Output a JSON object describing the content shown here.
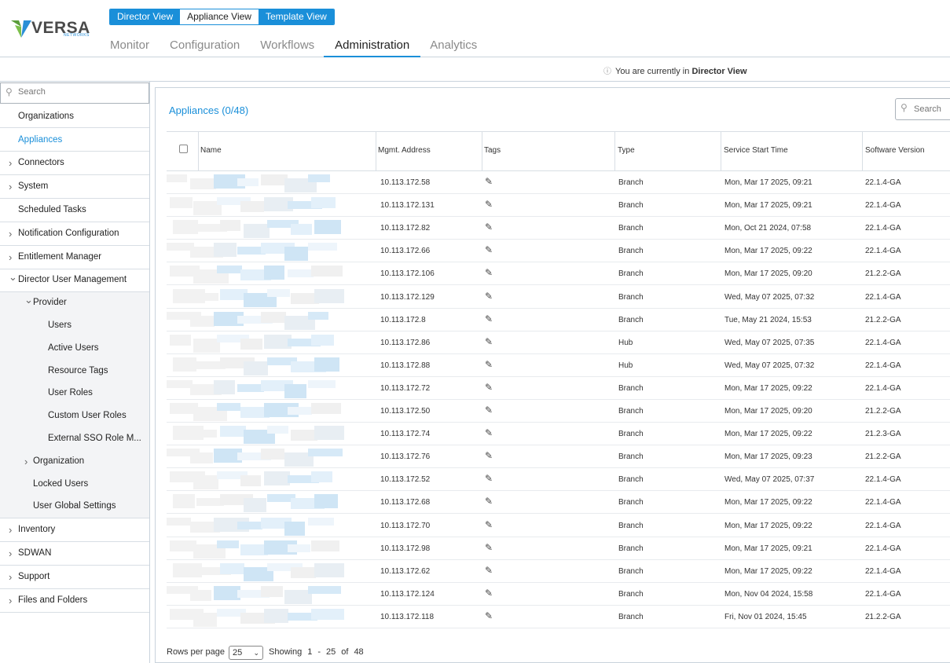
{
  "logo": {
    "text": "VERSA",
    "sub": "NETWORKS"
  },
  "views": [
    {
      "label": "Director View",
      "active": true
    },
    {
      "label": "Appliance View",
      "active": false
    },
    {
      "label": "Template View",
      "active": true
    }
  ],
  "main_tabs": [
    {
      "label": "Monitor",
      "active": false
    },
    {
      "label": "Configuration",
      "active": false
    },
    {
      "label": "Workflows",
      "active": false
    },
    {
      "label": "Administration",
      "active": true
    },
    {
      "label": "Analytics",
      "active": false
    }
  ],
  "info": {
    "prefix": "You are currently in",
    "view": "Director View"
  },
  "sidebar": {
    "search_placeholder": "Search",
    "items": [
      {
        "label": "Organizations",
        "level": 0,
        "chevron": ""
      },
      {
        "label": "Appliances",
        "level": 0,
        "chevron": "",
        "active": true
      },
      {
        "label": "Connectors",
        "level": 0,
        "chevron": "right"
      },
      {
        "label": "System",
        "level": 0,
        "chevron": "right"
      },
      {
        "label": "Scheduled Tasks",
        "level": 0,
        "chevron": ""
      },
      {
        "label": "Notification Configuration",
        "level": 0,
        "chevron": "right"
      },
      {
        "label": "Entitlement Manager",
        "level": 0,
        "chevron": "right"
      },
      {
        "label": "Director User Management",
        "level": 0,
        "chevron": "down"
      },
      {
        "label": "Provider",
        "level": 1,
        "chevron": "down"
      },
      {
        "label": "Users",
        "level": 2,
        "chevron": ""
      },
      {
        "label": "Active Users",
        "level": 2,
        "chevron": ""
      },
      {
        "label": "Resource Tags",
        "level": 2,
        "chevron": ""
      },
      {
        "label": "User Roles",
        "level": 2,
        "chevron": ""
      },
      {
        "label": "Custom User Roles",
        "level": 2,
        "chevron": ""
      },
      {
        "label": "External SSO Role M...",
        "level": 2,
        "chevron": ""
      },
      {
        "label": "Organization",
        "level": 1,
        "chevron": "right"
      },
      {
        "label": "Locked Users",
        "level": 1,
        "chevron": ""
      },
      {
        "label": "User Global Settings",
        "level": 1,
        "chevron": ""
      },
      {
        "label": "Inventory",
        "level": 0,
        "chevron": "right"
      },
      {
        "label": "SDWAN",
        "level": 0,
        "chevron": "right"
      },
      {
        "label": "Support",
        "level": 0,
        "chevron": "right"
      },
      {
        "label": "Files and Folders",
        "level": 0,
        "chevron": "right"
      }
    ]
  },
  "appliances": {
    "title": "Appliances (0/48)",
    "search_placeholder": "Search",
    "columns": [
      "Name",
      "Mgmt. Address",
      "Tags",
      "Type",
      "Service Start Time",
      "Software Version"
    ],
    "rows": [
      {
        "mgmt": "10.113.172.58",
        "type": "Branch",
        "start": "Mon, Mar 17 2025, 09:21",
        "version": "22.1.4-GA"
      },
      {
        "mgmt": "10.113.172.131",
        "type": "Branch",
        "start": "Mon, Mar 17 2025, 09:21",
        "version": "22.1.4-GA"
      },
      {
        "mgmt": "10.113.172.82",
        "type": "Branch",
        "start": "Mon, Oct 21 2024, 07:58",
        "version": "22.1.4-GA"
      },
      {
        "mgmt": "10.113.172.66",
        "type": "Branch",
        "start": "Mon, Mar 17 2025, 09:22",
        "version": "22.1.4-GA"
      },
      {
        "mgmt": "10.113.172.106",
        "type": "Branch",
        "start": "Mon, Mar 17 2025, 09:20",
        "version": "21.2.2-GA"
      },
      {
        "mgmt": "10.113.172.129",
        "type": "Branch",
        "start": "Wed, May 07 2025, 07:32",
        "version": "22.1.4-GA"
      },
      {
        "mgmt": "10.113.172.8",
        "type": "Branch",
        "start": "Tue, May 21 2024, 15:53",
        "version": "21.2.2-GA"
      },
      {
        "mgmt": "10.113.172.86",
        "type": "Hub",
        "start": "Wed, May 07 2025, 07:35",
        "version": "22.1.4-GA"
      },
      {
        "mgmt": "10.113.172.88",
        "type": "Hub",
        "start": "Wed, May 07 2025, 07:32",
        "version": "22.1.4-GA"
      },
      {
        "mgmt": "10.113.172.72",
        "type": "Branch",
        "start": "Mon, Mar 17 2025, 09:22",
        "version": "22.1.4-GA"
      },
      {
        "mgmt": "10.113.172.50",
        "type": "Branch",
        "start": "Mon, Mar 17 2025, 09:20",
        "version": "21.2.2-GA"
      },
      {
        "mgmt": "10.113.172.74",
        "type": "Branch",
        "start": "Mon, Mar 17 2025, 09:22",
        "version": "21.2.3-GA"
      },
      {
        "mgmt": "10.113.172.76",
        "type": "Branch",
        "start": "Mon, Mar 17 2025, 09:23",
        "version": "21.2.2-GA"
      },
      {
        "mgmt": "10.113.172.52",
        "type": "Branch",
        "start": "Wed, May 07 2025, 07:37",
        "version": "22.1.4-GA"
      },
      {
        "mgmt": "10.113.172.68",
        "type": "Branch",
        "start": "Mon, Mar 17 2025, 09:22",
        "version": "22.1.4-GA"
      },
      {
        "mgmt": "10.113.172.70",
        "type": "Branch",
        "start": "Mon, Mar 17 2025, 09:22",
        "version": "22.1.4-GA"
      },
      {
        "mgmt": "10.113.172.98",
        "type": "Branch",
        "start": "Mon, Mar 17 2025, 09:21",
        "version": "22.1.4-GA"
      },
      {
        "mgmt": "10.113.172.62",
        "type": "Branch",
        "start": "Mon, Mar 17 2025, 09:22",
        "version": "22.1.4-GA"
      },
      {
        "mgmt": "10.113.172.124",
        "type": "Branch",
        "start": "Mon, Nov 04 2024, 15:58",
        "version": "22.1.4-GA"
      },
      {
        "mgmt": "10.113.172.118",
        "type": "Branch",
        "start": "Fri, Nov 01 2024, 15:45",
        "version": "21.2.2-GA"
      }
    ]
  },
  "footer": {
    "rows_per_page_label": "Rows per page",
    "rows_per_page": "25",
    "showing_label": "Showing",
    "from": "1",
    "dash": "-",
    "to": "25",
    "of": "of",
    "total": "48"
  },
  "colors": {
    "accent": "#1a8fd9",
    "border": "#c9d3dc"
  }
}
